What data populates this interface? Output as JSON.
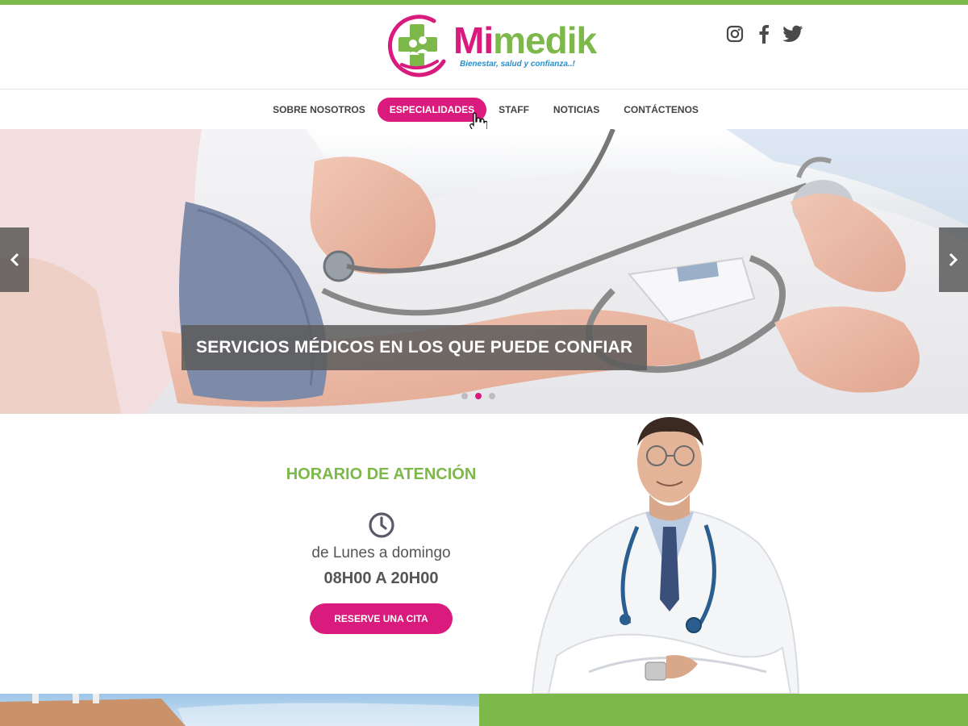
{
  "brand": {
    "name_part1": "Mi",
    "name_part2": "medik",
    "tagline": "Bienestar, salud y confianza..!",
    "pink": "#d81b7c",
    "green": "#7cb84a",
    "blue": "#2a8ec9"
  },
  "social": {
    "icons": [
      "instagram-icon",
      "facebook-icon",
      "twitter-icon"
    ],
    "icon_color": "#4a4a4a"
  },
  "nav": {
    "items": [
      {
        "label": "SOBRE NOSOTROS",
        "active": false
      },
      {
        "label": "ESPECIALIDADES",
        "active": true
      },
      {
        "label": "STAFF",
        "active": false
      },
      {
        "label": "NOTICIAS",
        "active": false
      },
      {
        "label": "CONTÁCTENOS",
        "active": false
      }
    ]
  },
  "slider": {
    "caption": "SERVICIOS MÉDICOS EN LOS QUE PUEDE CONFIAR",
    "slide_count": 3,
    "active_slide": 2,
    "prev_icon": "chevron-left-icon",
    "next_icon": "chevron-right-icon"
  },
  "hours": {
    "title": "HORARIO DE ATENCIÓN",
    "icon": "clock-icon",
    "days": "de  Lunes a domingo",
    "time": "08H00 A 20H00",
    "button_label": "RESERVE UNA CITA"
  }
}
